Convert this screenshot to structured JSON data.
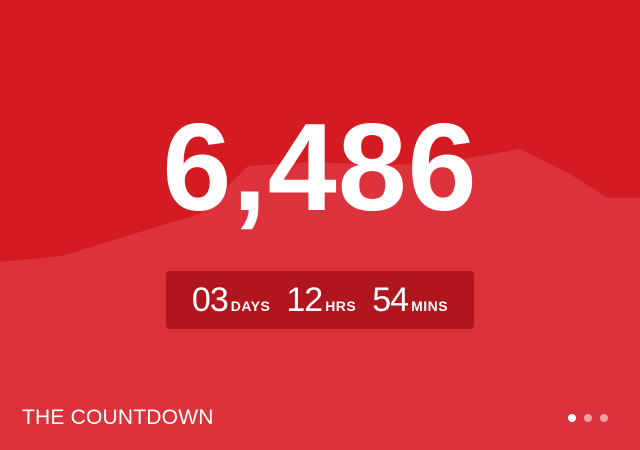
{
  "card": {
    "accent_color": "#d51b22",
    "wave_color": "#dc323b",
    "counter_box_color": "#b1151d"
  },
  "counter": {
    "value": "6,486"
  },
  "countdown": {
    "days": {
      "value": "03",
      "label": "DAYS"
    },
    "hours": {
      "value": "12",
      "label": "HRS"
    },
    "minutes": {
      "value": "54",
      "label": "MINS"
    }
  },
  "footer": {
    "title": "THE COUNTDOWN",
    "pagination": {
      "total": 3,
      "active": 1
    }
  }
}
